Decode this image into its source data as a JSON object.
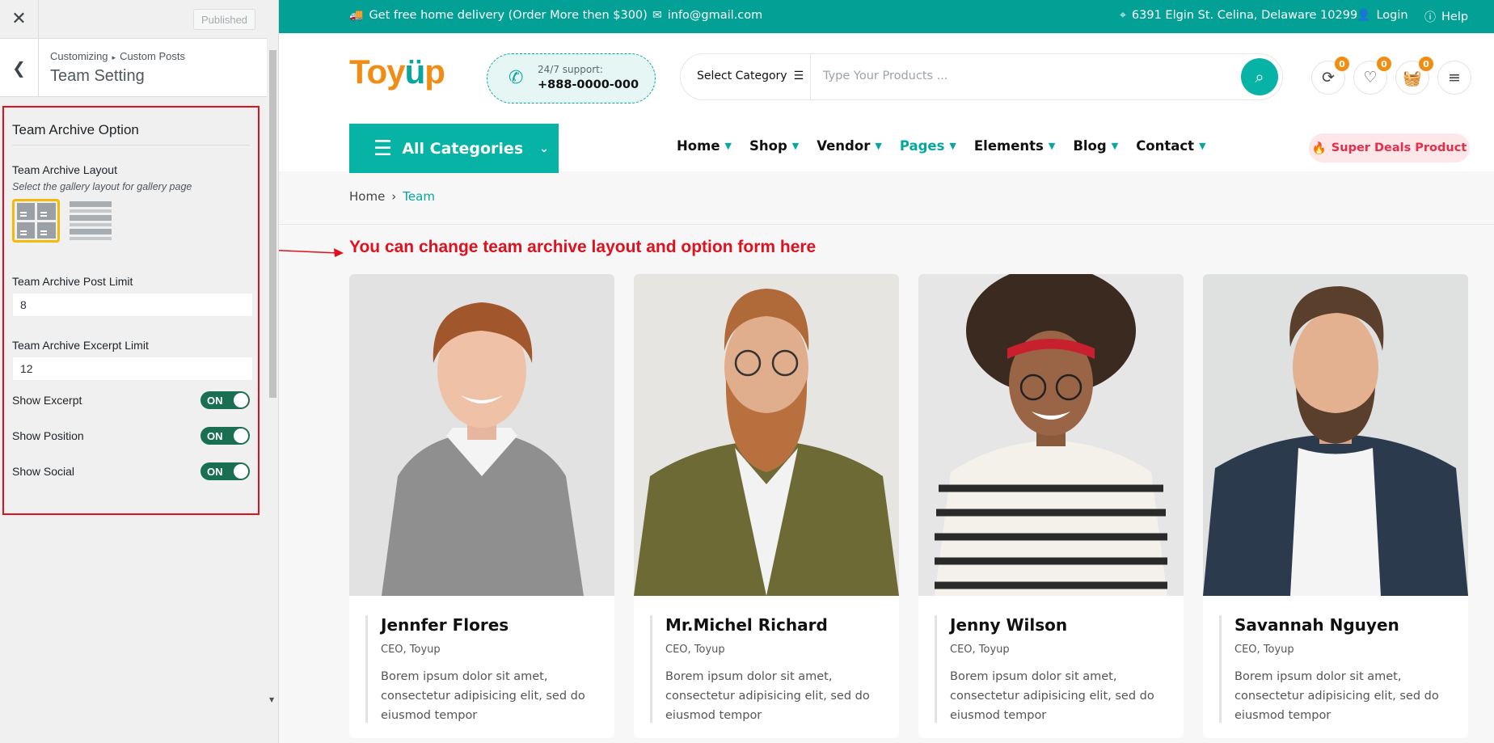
{
  "customizer": {
    "publish_label": "Published",
    "breadcrumb": [
      "Customizing",
      "Custom Posts"
    ],
    "section_title": "Team Setting",
    "panel_heading": "Team Archive Option",
    "layout": {
      "label": "Team Archive Layout",
      "description": "Select the gallery layout for gallery page",
      "options": [
        "grid",
        "list"
      ],
      "selected": "grid"
    },
    "post_limit": {
      "label": "Team Archive Post Limit",
      "value": "8"
    },
    "excerpt_limit": {
      "label": "Team Archive Excerpt Limit",
      "value": "12"
    },
    "toggles": [
      {
        "label": "Show Excerpt",
        "state": "ON"
      },
      {
        "label": "Show Position",
        "state": "ON"
      },
      {
        "label": "Show Social",
        "state": "ON"
      }
    ]
  },
  "site": {
    "topbar": {
      "delivery": "Get free home delivery (Order More then $300)",
      "email": "info@gmail.com",
      "address": "6391 Elgin St. Celina, Delaware 10299",
      "login": "Login",
      "help": "Help"
    },
    "logo": {
      "part1": "Toy",
      "part2": "ü",
      "part3": "p"
    },
    "support": {
      "label": "24/7 support:",
      "number": "+888-0000-000"
    },
    "search": {
      "category": "Select Category",
      "placeholder": "Type Your Products ..."
    },
    "header_icons": [
      {
        "icon": "compare-icon",
        "count": "0"
      },
      {
        "icon": "heart-icon",
        "count": "0"
      },
      {
        "icon": "basket-icon",
        "count": "0"
      }
    ],
    "all_categories": "All Categories",
    "menu": [
      "Home",
      "Shop",
      "Vendor",
      "Pages",
      "Elements",
      "Blog",
      "Contact"
    ],
    "active_menu": "Pages",
    "deals": "Super Deals Product",
    "breadcrumb": {
      "home": "Home",
      "current": "Team"
    },
    "annotation": "You can change team archive layout and option form here",
    "team": [
      {
        "name": "Jennfer Flores",
        "position": "CEO, Toyup",
        "desc": "Borem ipsum dolor sit amet, consectetur adipisicing elit, sed do eiusmod tempor"
      },
      {
        "name": "Mr.Michel Richard",
        "position": "CEO, Toyup",
        "desc": "Borem ipsum dolor sit amet, consectetur adipisicing elit, sed do eiusmod tempor"
      },
      {
        "name": "Jenny Wilson",
        "position": "CEO, Toyup",
        "desc": "Borem ipsum dolor sit amet, consectetur adipisicing elit, sed do eiusmod tempor"
      },
      {
        "name": "Savannah Nguyen",
        "position": "CEO, Toyup",
        "desc": "Borem ipsum dolor sit amet, consectetur adipisicing elit, sed do eiusmod tempor"
      }
    ],
    "colors": {
      "brand_teal": "#07a7a0",
      "accent_orange": "#f28d14",
      "annotation_red": "#e0101e",
      "toggle_green": "#1a6f52"
    }
  }
}
